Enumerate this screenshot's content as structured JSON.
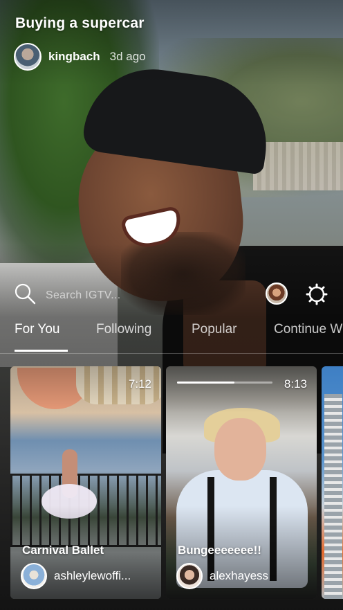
{
  "hero": {
    "title": "Buying a supercar",
    "author": "kingbach",
    "time_ago": "3d ago"
  },
  "search": {
    "placeholder": "Search IGTV..."
  },
  "tabs": [
    {
      "label": "For You",
      "active": true
    },
    {
      "label": "Following",
      "active": false
    },
    {
      "label": "Popular",
      "active": false
    },
    {
      "label": "Continue W",
      "active": false
    }
  ],
  "videos": [
    {
      "title": "Carnival Ballet",
      "author": "ashleylewoffi...",
      "duration": "7:12"
    },
    {
      "title": "Bungeeeeeee!!",
      "author": "alexhayess",
      "duration": "8:13",
      "progress": 0.6
    }
  ],
  "colors": {
    "text": "#ffffff",
    "muted_text": "#cccccc",
    "accent": "#ffffff"
  },
  "icons": {
    "search": "search-icon",
    "settings": "gear-icon"
  }
}
